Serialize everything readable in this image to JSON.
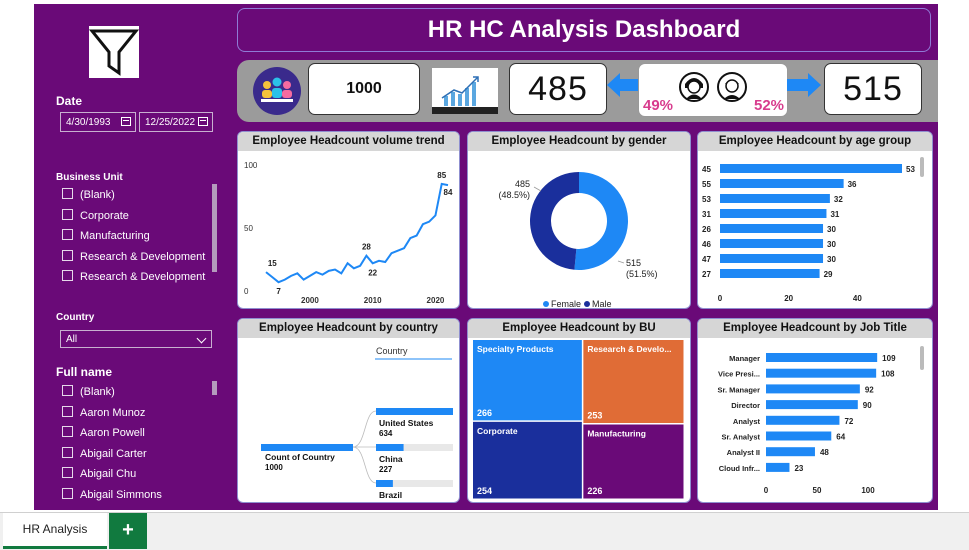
{
  "dashboard_title": "HR HC Analysis Dashboard",
  "filters": {
    "date_label": "Date",
    "date_start": "4/30/1993",
    "date_end": "12/25/2022",
    "business_unit_label": "Business Unit",
    "business_units": [
      "(Blank)",
      "Corporate",
      "Manufacturing",
      "Research & Development",
      "Research & Development"
    ],
    "country_label": "Country",
    "country_value": "All",
    "fullname_label": "Full name",
    "full_names": [
      "(Blank)",
      "Aaron Munoz",
      "Aaron Powell",
      "Abigail Carter",
      "Abigail Chu",
      "Abigail Simmons"
    ]
  },
  "kpis": {
    "total": "1000",
    "female": "485",
    "male": "515",
    "female_pct": "49%",
    "male_pct": "52%"
  },
  "colors": {
    "background": "#6a0a78",
    "primary_blue": "#1e88f5",
    "dark_blue": "#1a2f9c",
    "orange": "#e06c36",
    "purple": "#6a0a78",
    "pink_text": "#d83c8e"
  },
  "chart_data": [
    {
      "type": "line",
      "title": "Employee Headcount volume trend",
      "x": [
        1993,
        1994,
        1995,
        1996,
        1997,
        1998,
        1999,
        2000,
        2001,
        2002,
        2003,
        2004,
        2005,
        2006,
        2007,
        2008,
        2009,
        2010,
        2011,
        2012,
        2013,
        2014,
        2015,
        2016,
        2017,
        2018,
        2019,
        2020,
        2021,
        2022
      ],
      "values": [
        15,
        11,
        7,
        9,
        12,
        14,
        9,
        12,
        15,
        13,
        16,
        17,
        14,
        22,
        18,
        20,
        28,
        22,
        24,
        23,
        30,
        32,
        34,
        42,
        44,
        53,
        55,
        60,
        85,
        84
      ],
      "ylim": [
        0,
        100
      ],
      "yticks": [
        "0",
        "50",
        "100"
      ],
      "xticks": [
        "2000",
        "2010",
        "2020"
      ],
      "data_labels": [
        {
          "x": 1994,
          "value": 15,
          "text": "15"
        },
        {
          "x": 1995,
          "value": 7,
          "text": "7"
        },
        {
          "x": 2009,
          "value": 28,
          "text": "28"
        },
        {
          "x": 2010,
          "value": 22,
          "text": "22"
        },
        {
          "x": 2021,
          "value": 85,
          "text": "85"
        },
        {
          "x": 2022,
          "value": 84,
          "text": "84"
        }
      ]
    },
    {
      "type": "pie",
      "title": "Employee Headcount by gender",
      "categories": [
        "Female",
        "Male"
      ],
      "values": [
        515,
        485
      ],
      "labels": [
        {
          "value": "515",
          "pct": "(51.5%)"
        },
        {
          "value": "485",
          "pct": "(48.5%)"
        }
      ],
      "legend": [
        "Female",
        "Male"
      ],
      "colors": [
        "#1e88f5",
        "#1a2f9c"
      ]
    },
    {
      "type": "bar",
      "title": "Employee Headcount by age group",
      "categories": [
        "45",
        "55",
        "53",
        "31",
        "26",
        "46",
        "47",
        "27"
      ],
      "values": [
        53,
        36,
        32,
        31,
        30,
        30,
        30,
        29
      ],
      "xlim": [
        0,
        53
      ],
      "xticks": [
        "0",
        "20",
        "40"
      ],
      "tick_values": [
        0,
        20,
        40
      ]
    },
    {
      "type": "bar",
      "title": "Employee Headcount by country",
      "legend_title": "Country",
      "root_label": "Count of Country",
      "root_value": "1000",
      "categories": [
        "United States",
        "China",
        "Brazil"
      ],
      "values": [
        634,
        227,
        139
      ]
    },
    {
      "type": "heatmap",
      "title": "Employee Headcount by BU",
      "categories": [
        "Specialty Products",
        "Research & Develo...",
        "Corporate",
        "Manufacturing"
      ],
      "values": [
        266,
        253,
        254,
        226
      ],
      "colors": [
        "#1e88f5",
        "#e06c36",
        "#1a2f9c",
        "#6a0a78"
      ]
    },
    {
      "type": "bar",
      "title": "Employee Headcount by Job Title",
      "categories": [
        "Manager",
        "Vice Presi...",
        "Sr. Manager",
        "Director",
        "Analyst",
        "Sr. Analyst",
        "Analyst II",
        "Cloud Infr..."
      ],
      "values": [
        109,
        108,
        92,
        90,
        72,
        64,
        48,
        23
      ],
      "xticks": [
        "0",
        "50",
        "100"
      ],
      "tick_values": [
        0,
        50,
        100
      ],
      "xlim": [
        0,
        120
      ]
    }
  ],
  "sheet_tab": "HR Analysis",
  "add_tab": "+"
}
